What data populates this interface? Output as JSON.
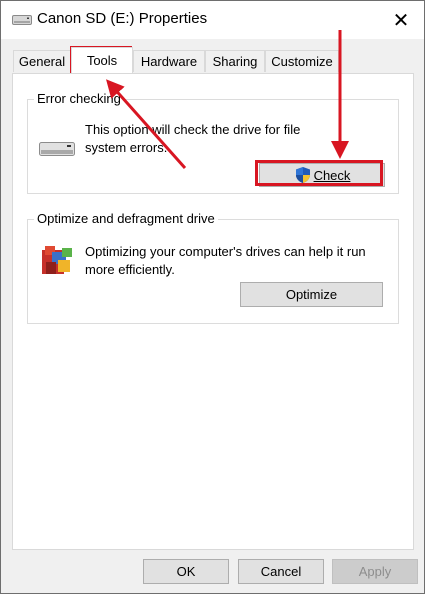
{
  "window": {
    "title": "Canon SD (E:) Properties"
  },
  "tabs": [
    {
      "label": "General"
    },
    {
      "label": "Tools"
    },
    {
      "label": "Hardware"
    },
    {
      "label": "Sharing"
    },
    {
      "label": "Customize"
    }
  ],
  "active_tab": "Tools",
  "error_checking": {
    "title": "Error checking",
    "desc_line1": "This option will check the drive for file",
    "desc_line2": "system errors.",
    "button_label": "Check"
  },
  "optimize": {
    "title": "Optimize and defragment drive",
    "desc_line1": "Optimizing your computer's drives can help it run",
    "desc_line2": "more efficiently.",
    "button_label": "Optimize"
  },
  "footer": {
    "ok_label": "OK",
    "cancel_label": "Cancel",
    "apply_label": "Apply"
  },
  "annotation_color": "#d81622"
}
